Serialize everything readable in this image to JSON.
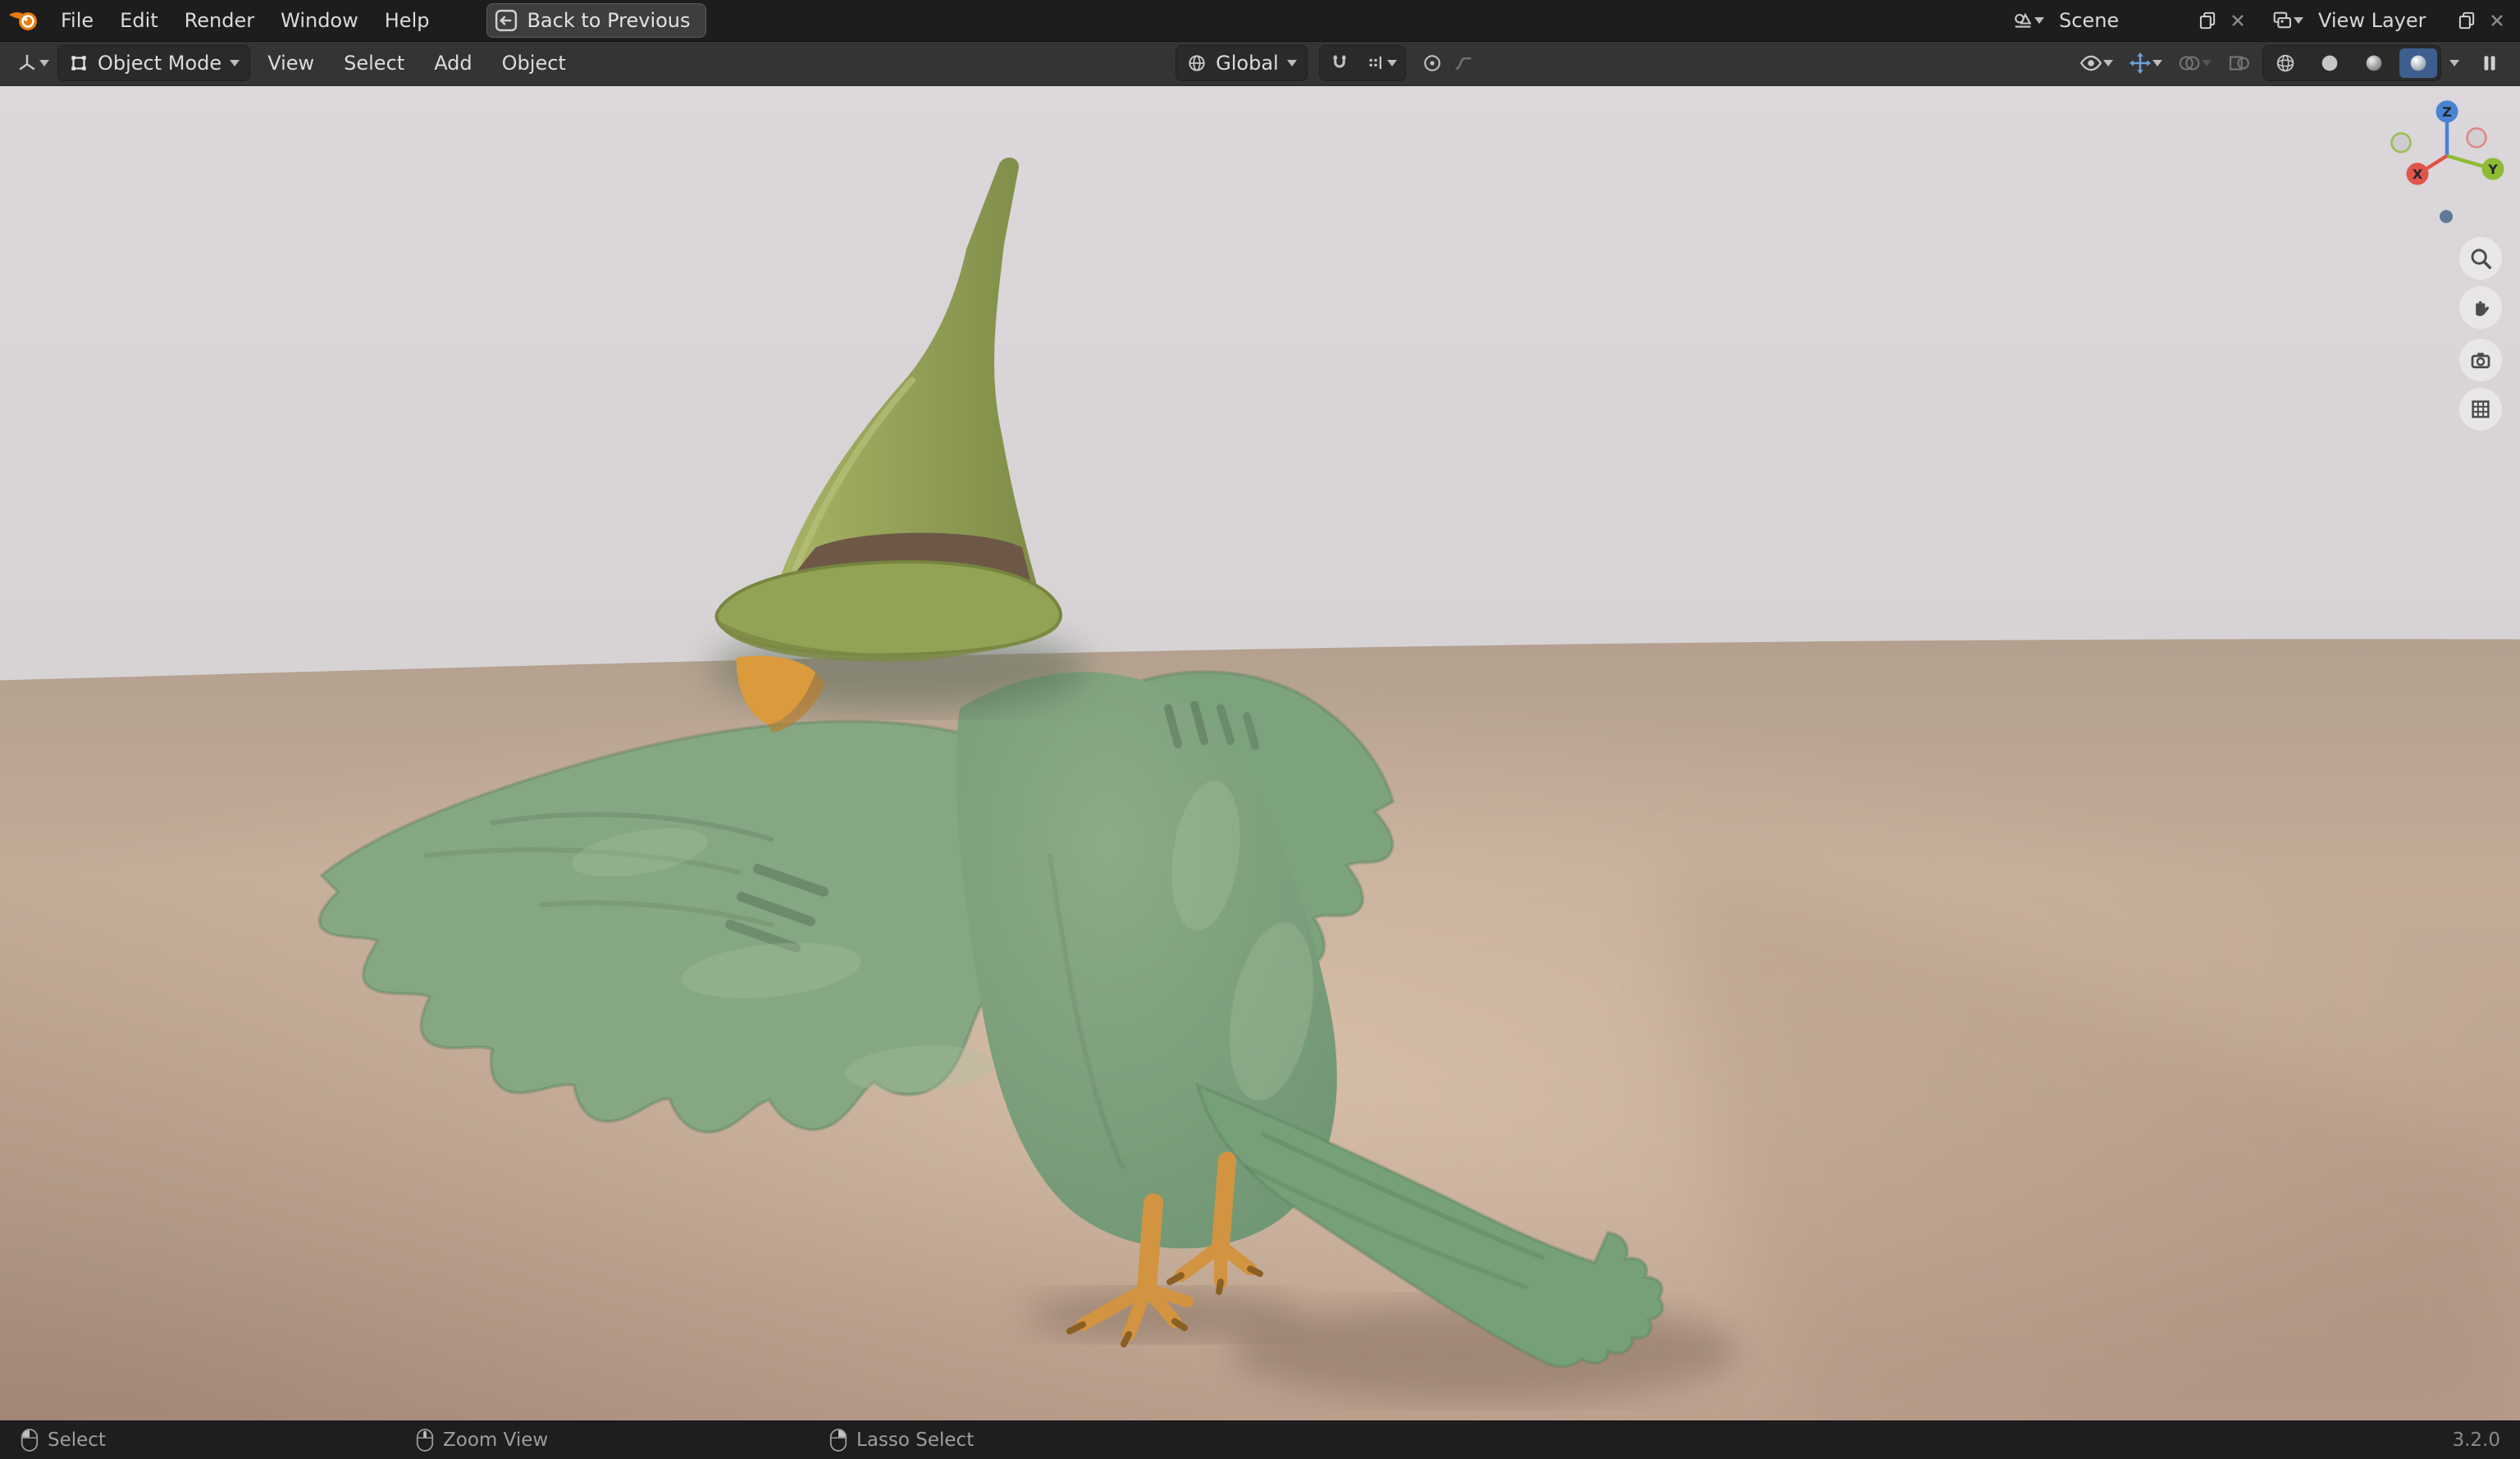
{
  "topbar": {
    "menus": [
      {
        "label": "File"
      },
      {
        "label": "Edit"
      },
      {
        "label": "Render"
      },
      {
        "label": "Window"
      },
      {
        "label": "Help"
      }
    ],
    "back_button": {
      "label": "Back to Previous"
    },
    "scene_block": {
      "value": "Scene"
    },
    "view_layer_block": {
      "value": "View Layer"
    }
  },
  "viewport_header": {
    "mode": {
      "label": "Object Mode"
    },
    "menus": [
      {
        "label": "View"
      },
      {
        "label": "Select"
      },
      {
        "label": "Add"
      },
      {
        "label": "Object"
      }
    ],
    "orientation": {
      "label": "Global"
    }
  },
  "nav_gizmo": {
    "axis_x": "X",
    "axis_y": "Y",
    "axis_z": "Z"
  },
  "status_bar": {
    "hints": [
      {
        "label": "Select"
      },
      {
        "label": "Zoom View"
      },
      {
        "label": "Lasso Select"
      }
    ],
    "version": "3.2.0"
  },
  "colors": {
    "accent_blue": "#4772b3",
    "axis_x_red": "#e0544c",
    "axis_y_green": "#8fbb33",
    "axis_z_blue": "#4a83d2",
    "hat_green": "#98a659",
    "hat_band_brown": "#6d5847",
    "bird_green": "#7fa381",
    "beak_orange": "#d8993c",
    "ground_tan": "#bca491",
    "sky_gray": "#d7d2d5"
  }
}
